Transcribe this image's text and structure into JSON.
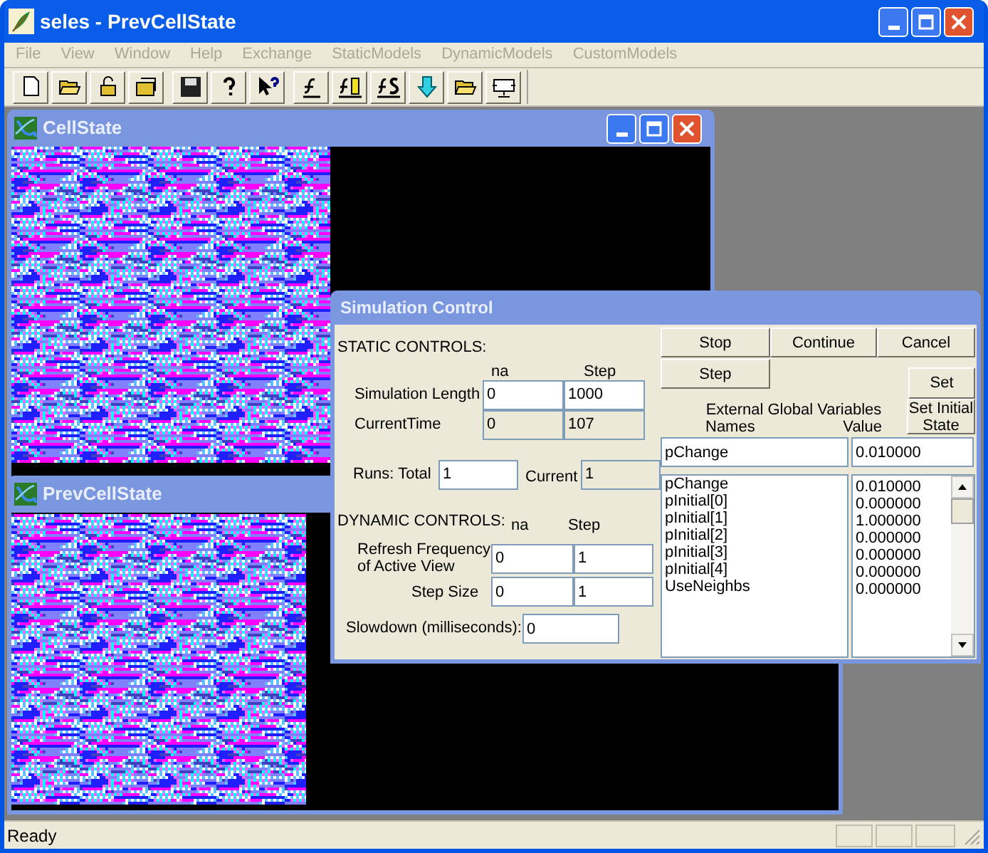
{
  "app_window": {
    "title": "seles - PrevCellState"
  },
  "menu": [
    {
      "label": "File",
      "disabled": true
    },
    {
      "label": "View",
      "disabled": true
    },
    {
      "label": "Window",
      "disabled": true
    },
    {
      "label": "Help",
      "disabled": true
    },
    {
      "label": "Exchange",
      "disabled": true
    },
    {
      "label": "StaticModels",
      "disabled": true
    },
    {
      "label": "DynamicModels",
      "disabled": true
    },
    {
      "label": "CustomModels",
      "disabled": true
    }
  ],
  "child_windows": [
    {
      "title": "CellState"
    },
    {
      "title": "PrevCellState"
    }
  ],
  "simulation_control": {
    "title": "Simulation Control",
    "static_heading": "STATIC CONTROLS:",
    "static_columns": [
      "na",
      "Step"
    ],
    "static_rows": [
      {
        "label": "Simulation Length",
        "na": "0",
        "step": "1000",
        "disabled": false
      },
      {
        "label": "CurrentTime",
        "na": "0",
        "step": "107",
        "disabled": true
      }
    ],
    "runs": {
      "total_label": "Runs: Total",
      "total": "1",
      "current_label": "Current",
      "current": "1"
    },
    "dynamic_heading": "DYNAMIC CONTROLS:",
    "dynamic_columns": [
      "na",
      "Step"
    ],
    "dynamic_rows": [
      {
        "label": "Refresh Frequency of Active View",
        "na": "0",
        "step": "1"
      },
      {
        "label": "Step Size",
        "na": "0",
        "step": "1"
      }
    ],
    "slowdown": {
      "label": "Slowdown (milliseconds):",
      "value": "0"
    },
    "buttons": [
      "Stop",
      "Continue",
      "Cancel"
    ],
    "step_button": "Step",
    "set_button": "Set",
    "set_initial_button": "Set Initial State",
    "variables_heading": "External Global Variables",
    "names_label": "Names",
    "value_label": "Value",
    "edit_name": "pChange",
    "edit_value": "0.010000",
    "variables": [
      {
        "name": "pChange",
        "value": "0.010000"
      },
      {
        "name": "pInitial[0]",
        "value": "0.000000"
      },
      {
        "name": "pInitial[1]",
        "value": "1.000000"
      },
      {
        "name": "pInitial[2]",
        "value": "0.000000"
      },
      {
        "name": "pInitial[3]",
        "value": "0.000000"
      },
      {
        "name": "pInitial[4]",
        "value": "0.000000"
      },
      {
        "name": "UseNeighbs",
        "value": "0.000000"
      }
    ]
  },
  "status_bar": {
    "text": "Ready"
  }
}
